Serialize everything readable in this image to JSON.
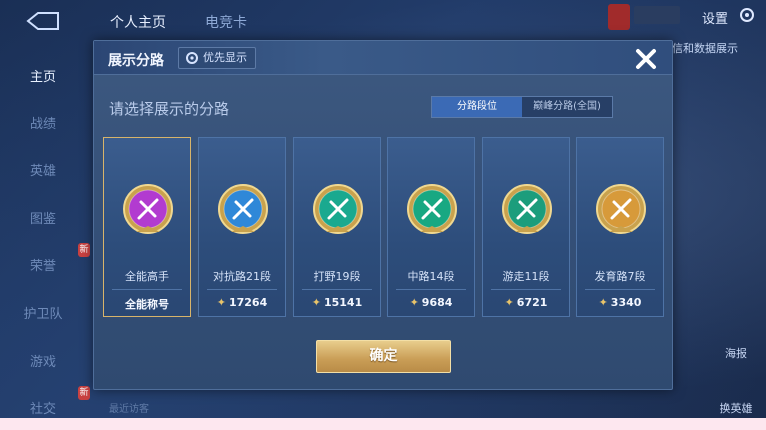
{
  "top": {
    "tabs": [
      "个人主页",
      "电竞卡"
    ],
    "settings_label": "设置",
    "behind_text": "信和数据展示"
  },
  "sidebar": {
    "items": [
      {
        "label": "主页"
      },
      {
        "label": "战绩"
      },
      {
        "label": "英雄"
      },
      {
        "label": "图鉴"
      },
      {
        "label": "荣誉",
        "badge": "新"
      },
      {
        "label": "护卫队"
      },
      {
        "label": "游戏"
      },
      {
        "label": "社交",
        "badge": "新"
      }
    ],
    "recent_label": "最近访客"
  },
  "right": {
    "poster": "海报",
    "switch_hero": "换英雄"
  },
  "modal": {
    "title": "展示分路",
    "priority_label": "优先显示",
    "subtitle": "请选择展示的分路",
    "seg_tabs": [
      "分路段位",
      "巅峰分路(全国)"
    ],
    "confirm_label": "确定",
    "cards": [
      {
        "name": "全能高手",
        "score": "全能称号",
        "icon": "allround-emblem",
        "color": "#b23bd0",
        "selected": true,
        "has_star": false
      },
      {
        "name": "对抗路21段",
        "score": "17264",
        "icon": "sword-emblem",
        "color": "#2f88d8",
        "selected": false,
        "has_star": true
      },
      {
        "name": "打野19段",
        "score": "15141",
        "icon": "dragon-emblem",
        "color": "#1aa98f",
        "selected": false,
        "has_star": true
      },
      {
        "name": "中路14段",
        "score": "9684",
        "icon": "mid-emblem",
        "color": "#18a882",
        "selected": false,
        "has_star": true
      },
      {
        "name": "游走11段",
        "score": "6721",
        "icon": "wing-emblem",
        "color": "#1c9d7c",
        "selected": false,
        "has_star": true
      },
      {
        "name": "发育路7段",
        "score": "3340",
        "icon": "bow-emblem",
        "color": "#d79a3a",
        "selected": false,
        "has_star": true
      }
    ]
  },
  "colors": {
    "accent_gold": "#d8b46a",
    "seg_active": "#3b6ab5"
  }
}
